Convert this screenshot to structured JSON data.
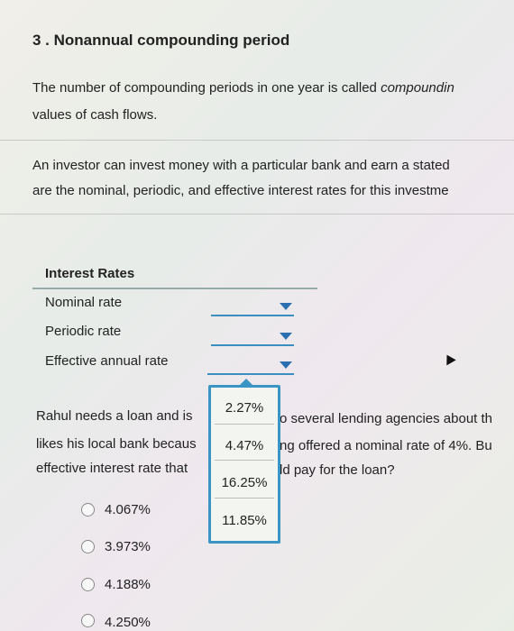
{
  "question": {
    "title": "3 . Nonannual compounding period",
    "para1_line1_prefix": "The number of compounding periods in one year is called ",
    "para1_line1_italic": "compoundin",
    "para1_line2": "values of cash flows.",
    "para2_line1": "An investor can invest money with a particular bank and earn a stated",
    "para2_line2": "are the nominal, periodic, and effective interest rates for this investme"
  },
  "table": {
    "header": "Interest Rates",
    "rows": [
      {
        "label": "Nominal rate",
        "value": ""
      },
      {
        "label": "Periodic rate",
        "value": ""
      },
      {
        "label": "Effective annual rate",
        "value": ""
      }
    ]
  },
  "dropdown_options": [
    "2.27%",
    "4.47%",
    "16.25%",
    "11.85%"
  ],
  "loan_question": {
    "line1_a": "Rahul needs a loan and is",
    "line1_b": "o several lending agencies about th",
    "line2_a": "likes his local bank becaus",
    "line2_b": "ng offered a nominal rate of 4%. Bu",
    "line3_a": "effective interest rate that",
    "line3_b": "ld pay for the loan?"
  },
  "answers": [
    "4.067%",
    "3.973%",
    "4.188%",
    "4.250%"
  ],
  "colors": {
    "accent": "#3a94c4",
    "arrow": "#2a6fb0"
  }
}
